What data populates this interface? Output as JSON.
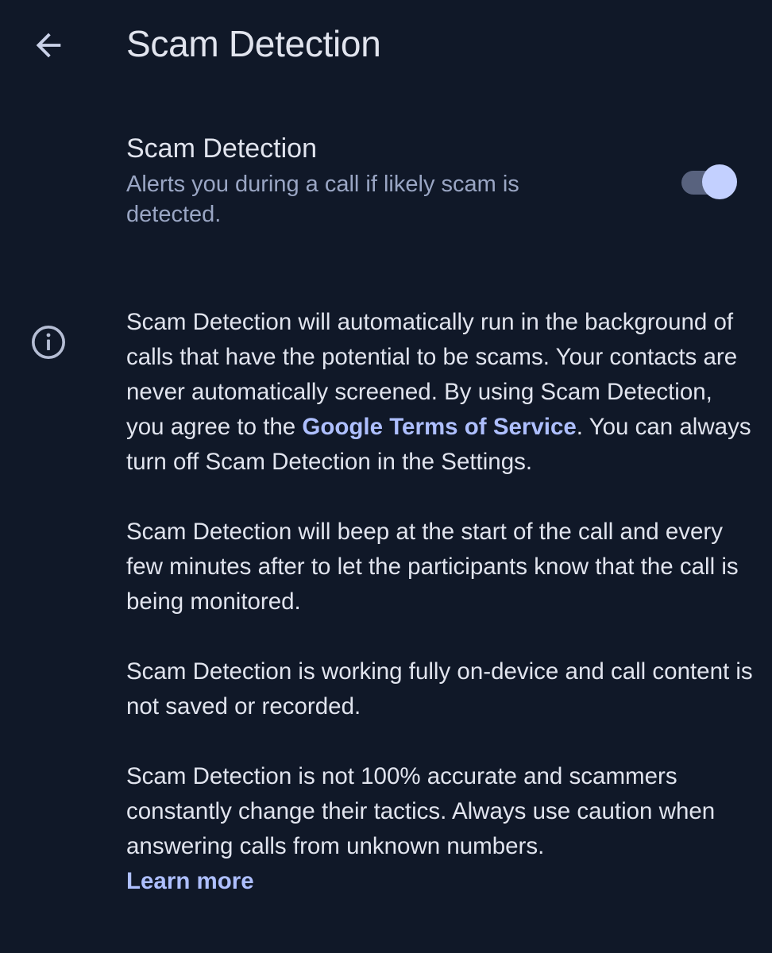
{
  "header": {
    "title": "Scam Detection",
    "back_icon": "arrow-back-icon"
  },
  "setting": {
    "title": "Scam Detection",
    "summary": "Alerts you during a call if likely scam is detected.",
    "toggle_on": true
  },
  "info": {
    "icon": "info-icon",
    "para1_before": "Scam Detection will automatically run in the background of calls that have the potential to be scams. Your contacts are never automatically screened. By using Scam Detection, you agree to the ",
    "para1_link": "Google Terms of Service",
    "para1_after": ". You can always turn off Scam Detection in the Settings.",
    "para2": "Scam Detection will beep at the start of the call and every few minutes after to let the participants know that the call is being monitored.",
    "para3": "Scam Detection is working fully on-device and call content is not saved or recorded.",
    "para4": "Scam Detection is not 100% accurate and scammers constantly change their tactics. Always use caution when answering calls from unknown numbers.",
    "learn_more": "Learn more"
  },
  "colors": {
    "background": "#101828",
    "text_primary": "#e1e4ee",
    "text_secondary": "#9aa6c4",
    "link": "#aebfff",
    "toggle_thumb": "#c3d0ff",
    "toggle_track": "#58627e"
  }
}
